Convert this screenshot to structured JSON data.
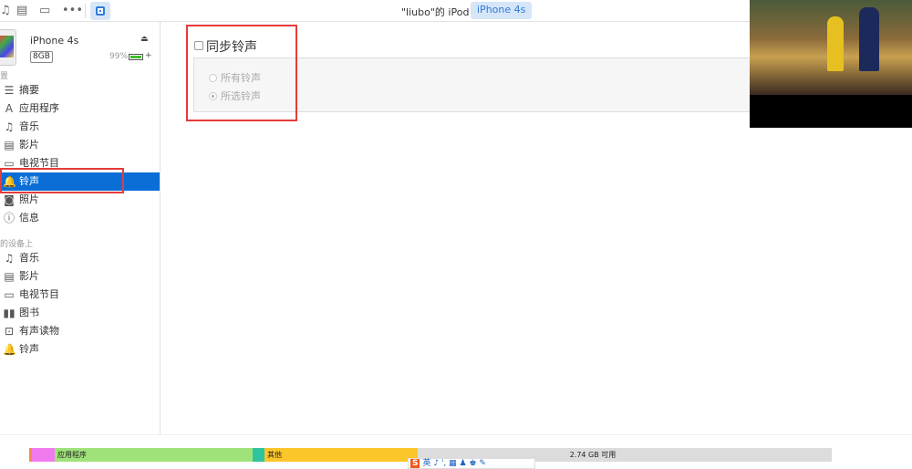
{
  "toolbar": {
    "title": "\"liubo\"的 iPod",
    "device_badge": "iPhone 4s",
    "icons": [
      "music-icon",
      "movie-icon",
      "tv-icon",
      "more-icon",
      "device-icon"
    ]
  },
  "device": {
    "name": "iPhone 4s",
    "capacity": "8GB",
    "battery": "99%",
    "battery_level": 0.99
  },
  "sidebar": {
    "section_settings": "置",
    "settings": [
      {
        "label": "摘要",
        "icon": "☰"
      },
      {
        "label": "应用程序",
        "icon": "A"
      },
      {
        "label": "音乐",
        "icon": "♫"
      },
      {
        "label": "影片",
        "icon": "▤"
      },
      {
        "label": "电视节目",
        "icon": "▭"
      },
      {
        "label": "铃声",
        "icon": "🔔"
      },
      {
        "label": "照片",
        "icon": "◙"
      },
      {
        "label": "信息",
        "icon": "ⓘ"
      }
    ],
    "section_on_device": "的设备上",
    "on_device": [
      {
        "label": "音乐",
        "icon": "♫"
      },
      {
        "label": "影片",
        "icon": "▤"
      },
      {
        "label": "电视节目",
        "icon": "▭"
      },
      {
        "label": "图书",
        "icon": "▮▮"
      },
      {
        "label": "有声读物",
        "icon": "⊡"
      },
      {
        "label": "铃声",
        "icon": "🔔"
      }
    ]
  },
  "main": {
    "sync_label": "同步铃声",
    "sync_checked": false,
    "options": [
      "所有铃声",
      "所选铃声"
    ],
    "selected_option": "所选铃声"
  },
  "storage": {
    "segments": [
      {
        "label": "",
        "color": "#f28a4c"
      },
      {
        "label": "",
        "color": "#ef7bef"
      },
      {
        "label": "应用程序",
        "color": "#9fe27a"
      },
      {
        "label": "",
        "color": "#2ec4a0"
      },
      {
        "label": "其他",
        "color": "#fbc62a"
      },
      {
        "label": "2.74 GB 可用",
        "color": "#dcdcdc"
      }
    ]
  },
  "ime": {
    "logo": "S",
    "text": "英 ♪ ', ▦ ♟ ♚ ✎"
  },
  "colors": {
    "accent": "#0a6ed6",
    "annotation": "#e53b3b"
  }
}
